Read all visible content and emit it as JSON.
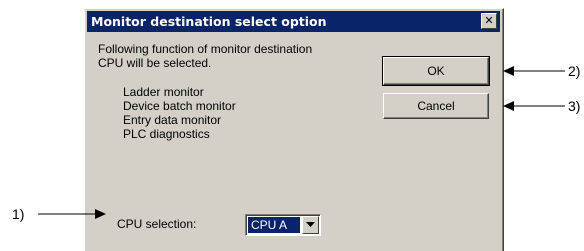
{
  "dialog": {
    "title": "Monitor destination select option",
    "close_glyph": "✕",
    "description_line1": "Following function of monitor destination",
    "description_line2": "CPU will be selected.",
    "functions": [
      "Ladder monitor",
      "Device batch monitor",
      "Entry data monitor",
      "PLC diagnostics"
    ],
    "cpu_label": "CPU selection:",
    "cpu_value": "CPU A",
    "ok_label": "OK",
    "cancel_label": "Cancel"
  },
  "callouts": {
    "cpu_selection": "1)",
    "ok": "2)",
    "cancel": "3)"
  }
}
